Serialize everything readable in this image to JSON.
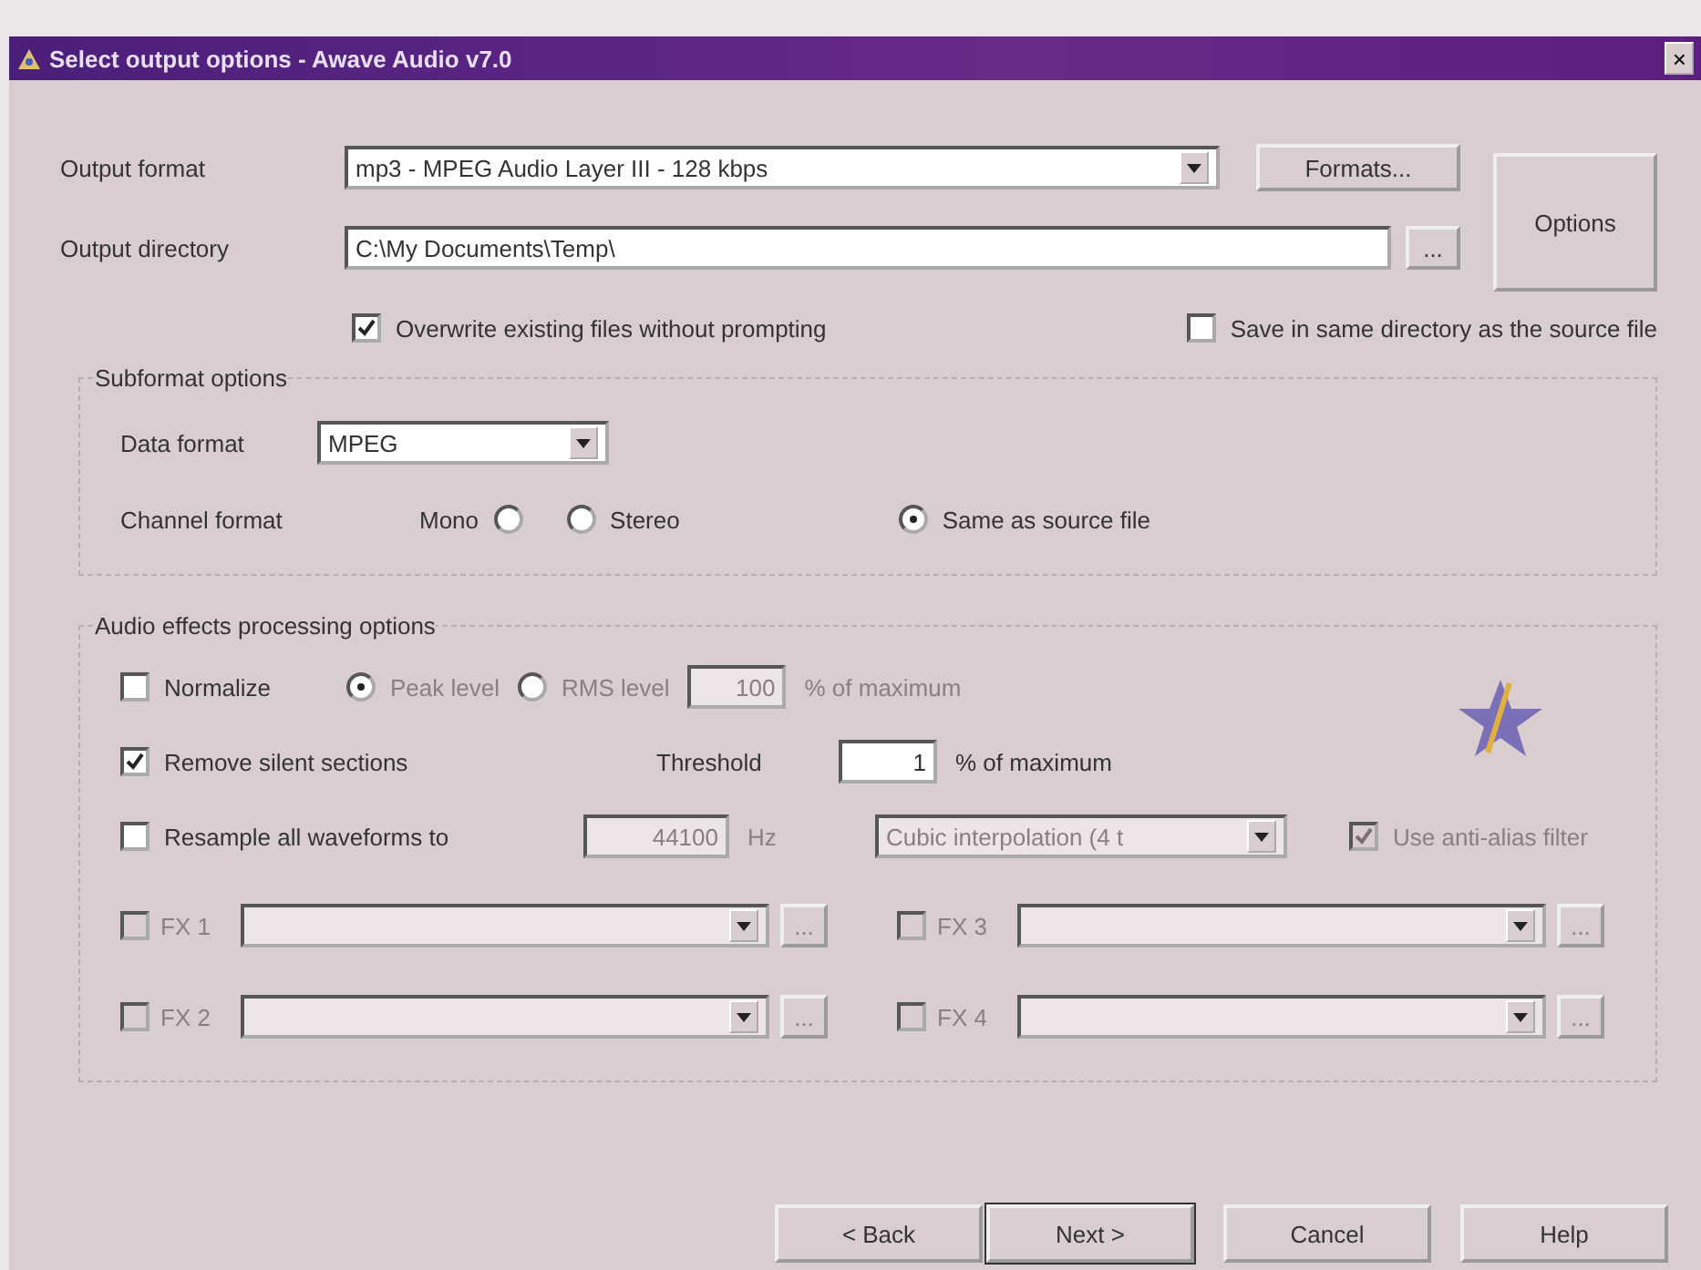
{
  "window": {
    "title": "Select output options - Awave Audio v7.0",
    "close": "×"
  },
  "output_format": {
    "label": "Output format",
    "value": "mp3 - MPEG Audio Layer III - 128 kbps"
  },
  "formats_button": "Formats...",
  "options_button": "Options",
  "output_directory": {
    "label": "Output directory",
    "value": "C:\\My Documents\\Temp\\",
    "browse": "..."
  },
  "checks": [
    {
      "label": "Overwrite existing files without prompting",
      "checked": true
    },
    {
      "label": "Save in same directory as the source file",
      "checked": false
    }
  ],
  "subformat": {
    "title": "Subformat options",
    "data_format": {
      "label": "Data format",
      "value": "MPEG"
    },
    "channel_label": "Channel format",
    "channels": [
      {
        "label": "Mono",
        "selected": false,
        "kind": "label_left"
      },
      {
        "label": "Stereo",
        "selected": false,
        "kind": "label_right"
      },
      {
        "label": "Same as source file",
        "selected": true,
        "kind": "label_right"
      }
    ]
  },
  "effects": {
    "title": "Audio effects processing options",
    "normalize": {
      "label": "Normalize",
      "checked": false,
      "options": [
        {
          "label": "Peak level",
          "selected": true
        },
        {
          "label": "RMS level",
          "selected": false
        }
      ],
      "value": "100",
      "unit": "% of maximum"
    },
    "silence": {
      "label": "Remove silent sections",
      "checked": true,
      "threshold_label": "Threshold",
      "value": "1",
      "unit": "% of maximum"
    },
    "resample": {
      "label": "Resample all waveforms to",
      "checked": false,
      "value": "44100",
      "unit": "Hz",
      "method": "Cubic interpolation (4 t",
      "filter": {
        "label": "Use anti-alias filter",
        "checked": true
      }
    },
    "fx": [
      {
        "label": "FX 1",
        "checked": false
      },
      {
        "label": "FX 3",
        "checked": false
      },
      {
        "label": "FX 2",
        "checked": false
      },
      {
        "label": "FX 4",
        "checked": false
      }
    ]
  },
  "buttons": [
    "< Back",
    "Next >",
    "Cancel",
    "Help"
  ]
}
